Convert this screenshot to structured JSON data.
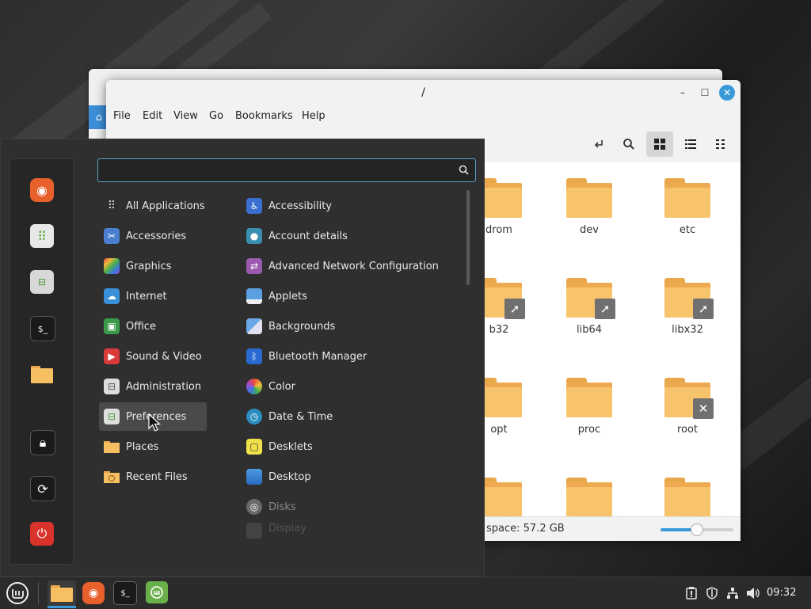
{
  "file_manager": {
    "title": "/",
    "menus": [
      "File",
      "Edit",
      "View",
      "Go",
      "Bookmarks",
      "Help"
    ],
    "files": [
      {
        "name": "drom",
        "badge": ""
      },
      {
        "name": "dev",
        "badge": ""
      },
      {
        "name": "etc",
        "badge": ""
      },
      {
        "name": "b32",
        "badge": "link"
      },
      {
        "name": "lib64",
        "badge": "link"
      },
      {
        "name": "libx32",
        "badge": "link"
      },
      {
        "name": "opt",
        "badge": ""
      },
      {
        "name": "proc",
        "badge": ""
      },
      {
        "name": "root",
        "badge": "no-access"
      },
      {
        "name": "",
        "badge": ""
      },
      {
        "name": "",
        "badge": ""
      },
      {
        "name": "",
        "badge": ""
      }
    ],
    "status": "space: 57.2 GB",
    "zoom_level": 0.5,
    "accent_color": "#3a9ad9"
  },
  "menu": {
    "search": {
      "value": "",
      "placeholder": ""
    },
    "categories": [
      {
        "label": "All Applications",
        "icon": "grid-icon"
      },
      {
        "label": "Accessories",
        "icon": "scissors-icon"
      },
      {
        "label": "Graphics",
        "icon": "graphics-icon"
      },
      {
        "label": "Internet",
        "icon": "cloud-icon"
      },
      {
        "label": "Office",
        "icon": "office-icon"
      },
      {
        "label": "Sound & Video",
        "icon": "play-icon"
      },
      {
        "label": "Administration",
        "icon": "admin-icon"
      },
      {
        "label": "Preferences",
        "icon": "preferences-icon"
      },
      {
        "label": "Places",
        "icon": "folder-icon"
      },
      {
        "label": "Recent Files",
        "icon": "recent-icon"
      }
    ],
    "apps": [
      {
        "label": "Accessibility",
        "icon": "accessibility-icon"
      },
      {
        "label": "Account details",
        "icon": "account-icon"
      },
      {
        "label": "Advanced Network Configuration",
        "icon": "network-icon"
      },
      {
        "label": "Applets",
        "icon": "applets-icon"
      },
      {
        "label": "Backgrounds",
        "icon": "backgrounds-icon"
      },
      {
        "label": "Bluetooth Manager",
        "icon": "bluetooth-icon"
      },
      {
        "label": "Color",
        "icon": "color-icon"
      },
      {
        "label": "Date & Time",
        "icon": "clock-icon"
      },
      {
        "label": "Desklets",
        "icon": "desklets-icon"
      },
      {
        "label": "Desktop",
        "icon": "desktop-icon"
      },
      {
        "label": "Disks",
        "icon": "disks-icon"
      },
      {
        "label": "Display",
        "icon": "display-icon"
      }
    ],
    "sidebar": [
      "firefox-icon",
      "software-manager-icon",
      "settings-icon",
      "terminal-icon",
      "files-icon",
      "lock-icon",
      "logout-icon",
      "power-icon"
    ]
  },
  "taskbar": {
    "items": [
      "mint-menu-icon",
      "files-icon",
      "firefox-icon",
      "terminal-icon",
      "mintinstall-icon"
    ],
    "tray": [
      "update-icon",
      "shield-icon",
      "network-icon",
      "volume-icon"
    ],
    "clock": "09:32"
  }
}
